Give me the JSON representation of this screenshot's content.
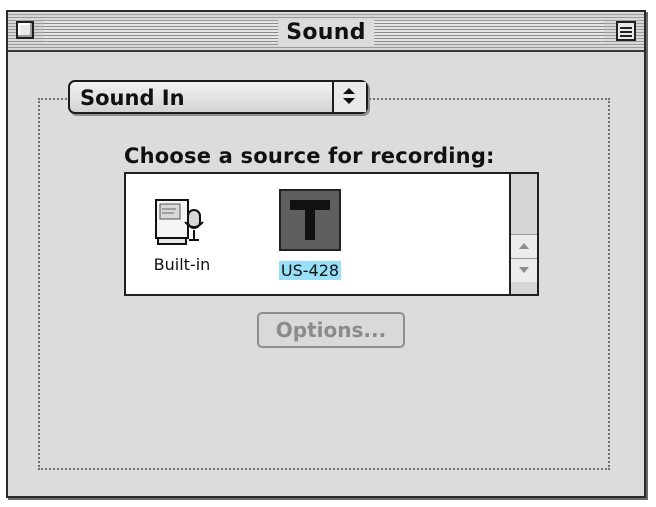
{
  "window": {
    "title": "Sound"
  },
  "popup": {
    "selected_value": "Sound In"
  },
  "source_list": {
    "heading": "Choose a source for recording:",
    "items": [
      {
        "label": "Built-in",
        "icon": "microphone-computer-icon",
        "selected": false
      },
      {
        "label": "US-428",
        "icon": "usb-device-icon",
        "selected": true
      }
    ]
  },
  "buttons": {
    "options": "Options..."
  },
  "colors": {
    "selection_highlight": "#98dff8",
    "disabled_text": "#8b8b8b"
  }
}
